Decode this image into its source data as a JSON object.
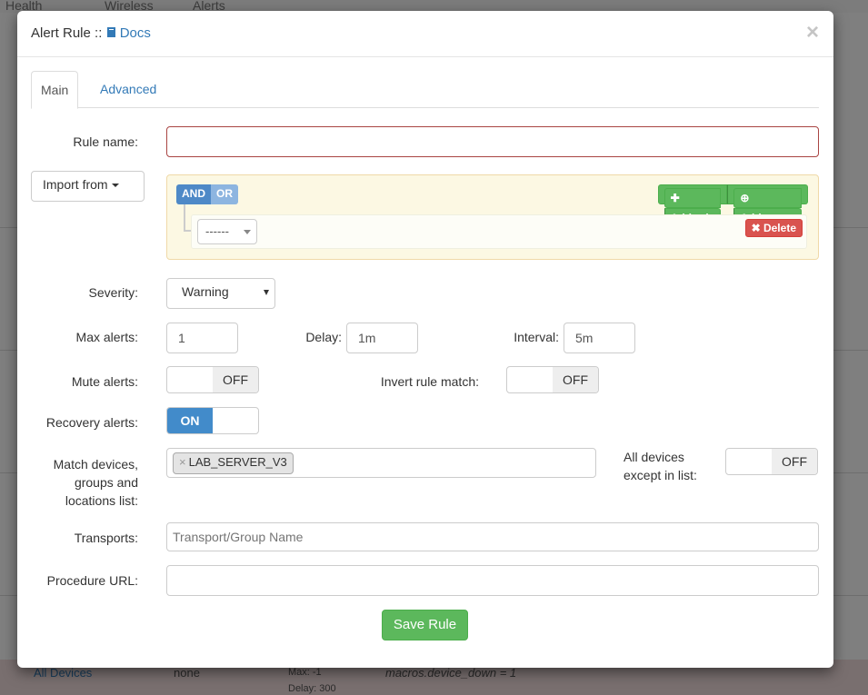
{
  "background": {
    "nav": [
      "Health",
      "Wireless",
      "Alerts"
    ],
    "row": {
      "link": "All Devices",
      "col2": "none",
      "col3a": "Max: -1",
      "col3b": "Delay: 300",
      "col4": "macros.device_down = 1"
    }
  },
  "modal": {
    "title_prefix": "Alert Rule ::",
    "title_link": "Docs",
    "close": "×",
    "tabs": [
      "Main",
      "Advanced"
    ],
    "rule_name": {
      "label": "Rule name:",
      "value": ""
    },
    "import_label": "Import from",
    "builder": {
      "and": "AND",
      "or": "OR",
      "add_rule": "Add rule",
      "add_group": "Add group",
      "selector": "------",
      "delete": "Delete"
    },
    "severity": {
      "label": "Severity:",
      "value": "Warning"
    },
    "max_alerts": {
      "label": "Max alerts:",
      "value": "1"
    },
    "delay": {
      "label": "Delay:",
      "value": "1m"
    },
    "interval": {
      "label": "Interval:",
      "value": "5m"
    },
    "mute": {
      "label": "Mute alerts:",
      "state": "OFF"
    },
    "invert": {
      "label": "Invert rule match:",
      "state": "OFF"
    },
    "recovery": {
      "label": "Recovery alerts:",
      "state": "ON"
    },
    "match": {
      "label_1": "Match devices,",
      "label_2": "groups and",
      "label_3": "locations list:",
      "tag": "LAB_SERVER_V3"
    },
    "all_devices": {
      "label_1": "All devices",
      "label_2": "except in list:",
      "state": "OFF"
    },
    "transports": {
      "label": "Transports:",
      "placeholder": "Transport/Group Name"
    },
    "procedure": {
      "label": "Procedure URL:",
      "value": ""
    },
    "save": "Save Rule"
  }
}
